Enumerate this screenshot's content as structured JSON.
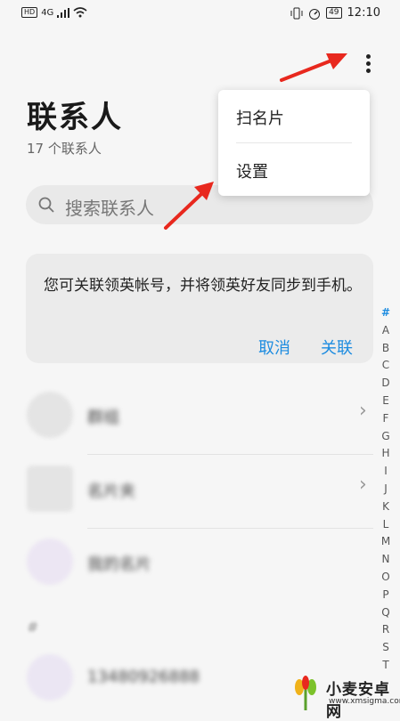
{
  "status_bar": {
    "hd": "HD",
    "network": "4G",
    "battery": "49",
    "time": "12:10"
  },
  "header": {
    "title": "联系人",
    "subtitle": "17 个联系人"
  },
  "search": {
    "placeholder": "搜索联系人"
  },
  "banner": {
    "message": "您可关联领英帐号，并将领英好友同步到手机。",
    "cancel_label": "取消",
    "link_label": "关联"
  },
  "list": [
    {
      "name": "群组",
      "icon": "group-icon",
      "chevron": true
    },
    {
      "name": "名片夹",
      "icon": "card-holder-icon",
      "chevron": true
    },
    {
      "name": "我的名片",
      "icon": "avatar-icon",
      "chevron": false
    }
  ],
  "section_header": "#",
  "contact": {
    "name": "13480926888"
  },
  "index_letters": [
    "#",
    "A",
    "B",
    "C",
    "D",
    "E",
    "F",
    "G",
    "H",
    "I",
    "J",
    "K",
    "L",
    "M",
    "N",
    "O",
    "P",
    "Q",
    "R",
    "S",
    "T"
  ],
  "menu": {
    "items": [
      "扫名片",
      "设置"
    ]
  },
  "watermark": {
    "name": "小麦安卓网",
    "url": "www.xmsigma.com"
  },
  "colors": {
    "accent": "#1d8ce0",
    "arrow": "#e8281e"
  }
}
